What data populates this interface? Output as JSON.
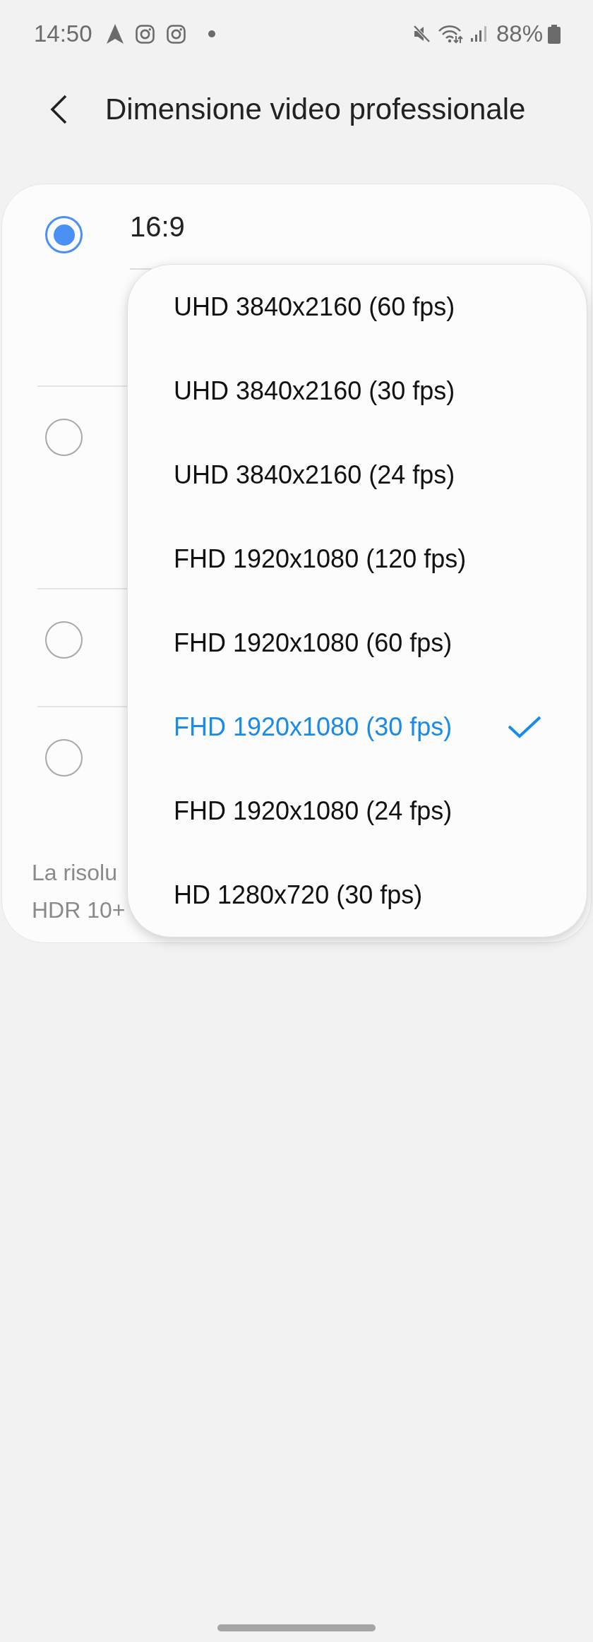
{
  "status_bar": {
    "time": "14:50",
    "battery": "88%"
  },
  "header": {
    "title": "Dimensione video professionale"
  },
  "aspect_options": [
    {
      "label": "16:9",
      "selected": true
    },
    {
      "selected": false
    },
    {
      "selected": false
    },
    {
      "selected": false
    }
  ],
  "description_lines": [
    "La risolu",
    "HDR 10+"
  ],
  "resolution_menu": {
    "options": [
      {
        "label": "UHD 3840x2160 (60 fps)",
        "selected": false
      },
      {
        "label": "UHD 3840x2160 (30 fps)",
        "selected": false
      },
      {
        "label": "UHD 3840x2160 (24 fps)",
        "selected": false
      },
      {
        "label": "FHD 1920x1080 (120 fps)",
        "selected": false
      },
      {
        "label": "FHD 1920x1080 (60 fps)",
        "selected": false
      },
      {
        "label": "FHD 1920x1080 (30 fps)",
        "selected": true
      },
      {
        "label": "FHD 1920x1080 (24 fps)",
        "selected": false
      },
      {
        "label": "HD 1280x720 (30 fps)",
        "selected": false
      }
    ]
  }
}
